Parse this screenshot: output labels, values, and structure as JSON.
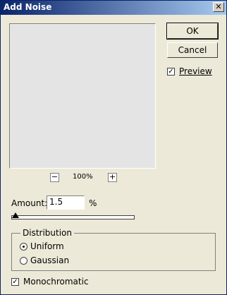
{
  "window": {
    "title": "Add Noise",
    "close_label": "✕"
  },
  "preview": {
    "zoom_level": "100%",
    "zoom_out": "−",
    "zoom_in": "+"
  },
  "buttons": {
    "ok": "OK",
    "cancel": "Cancel"
  },
  "preview_toggle": {
    "label": "Preview",
    "checked": true
  },
  "amount": {
    "label": "Amount:",
    "value": "1.5",
    "unit": "%"
  },
  "distribution": {
    "title": "Distribution",
    "options": [
      "Uniform",
      "Gaussian"
    ],
    "selected": "Uniform"
  },
  "monochromatic": {
    "label": "Monochromatic",
    "checked": true
  },
  "slider": {
    "level": 0.015
  }
}
